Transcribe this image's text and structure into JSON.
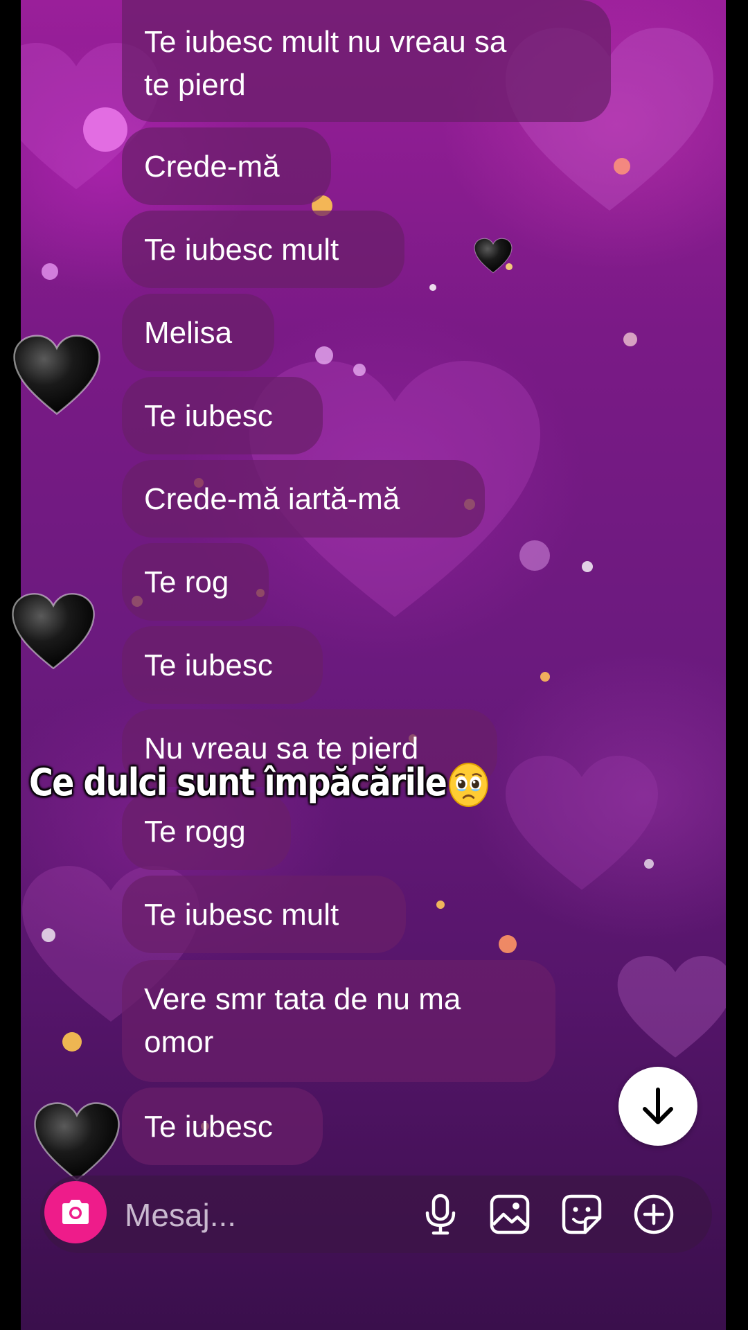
{
  "messages": [
    {
      "text": "Te iubesc mult nu vreau sa\nte pierd"
    },
    {
      "text": "Crede-mă"
    },
    {
      "text": "Te iubesc mult"
    },
    {
      "text": "Melisa"
    },
    {
      "text": "Te iubesc"
    },
    {
      "text": "Crede-mă iartă-mă"
    },
    {
      "text": "Te rog"
    },
    {
      "text": "Te iubesc"
    },
    {
      "text": "Nu vreau sa te pierd"
    },
    {
      "text": "Te rogg"
    },
    {
      "text": "Te iubesc mult"
    },
    {
      "text": "Vere smr tata de nu ma\nomor"
    },
    {
      "text": "Te iubesc"
    }
  ],
  "overlay": {
    "caption": "Ce dulci sunt împăcările",
    "emoji": "face-holding-back-tears"
  },
  "composer": {
    "placeholder": "Mesaj...",
    "camera_icon": "camera-icon",
    "mic_icon": "microphone-icon",
    "gallery_icon": "image-icon",
    "sticker_icon": "sticker-icon",
    "more_icon": "plus-circle-icon"
  },
  "scroll_button": {
    "icon": "arrow-down-icon"
  },
  "colors": {
    "bubble": "#691e69",
    "camera": "#ee1c8a",
    "background_top": "#9a1f9a",
    "background_bottom": "#3a0f4c"
  }
}
